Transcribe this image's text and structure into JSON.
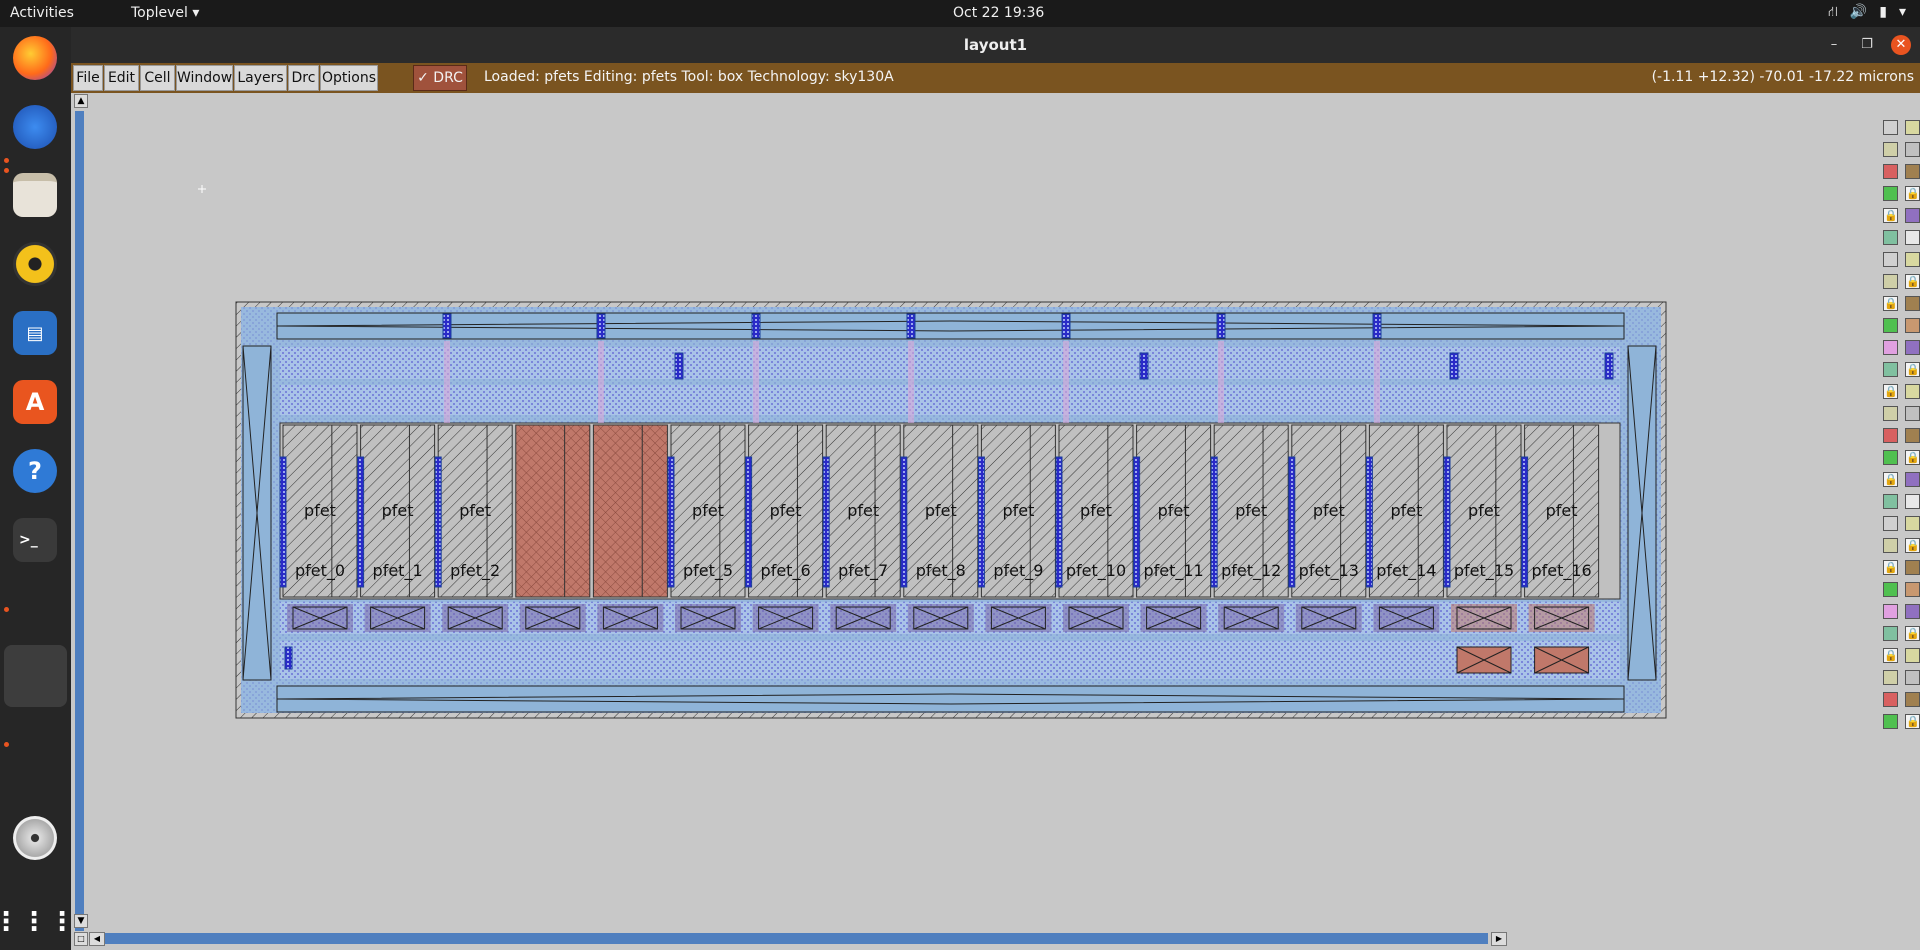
{
  "topbar": {
    "activities": "Activities",
    "app_menu": "Toplevel ▾",
    "clock": "Oct 22  19:36",
    "tray": [
      "⛙",
      "🔊",
      "▮",
      "▾"
    ]
  },
  "window": {
    "title": "layout1",
    "min": "–",
    "max": "❐",
    "close": "✕"
  },
  "menu": {
    "items": [
      "File",
      "Edit",
      "Cell",
      "Window",
      "Layers",
      "Drc",
      "Options"
    ],
    "drc_toggle": "✓ DRC",
    "status": "Loaded: pfets Editing: pfets Tool: box  Technology: sky130A",
    "coords": "(-1.11 +12.32) -70.01 -17.22 microns"
  },
  "layout": {
    "device_type": "pfet",
    "devices": [
      "pfet_0",
      "pfet_1",
      "pfet_2",
      "",
      "",
      "pfet_5",
      "pfet_6",
      "pfet_7",
      "pfet_8",
      "pfet_9",
      "pfet_10",
      "pfet_11",
      "pfet_12",
      "pfet_13",
      "pfet_14",
      "pfet_15",
      "pfet_16"
    ],
    "colors": {
      "nwell": "#8fb4d8",
      "diff": "#a9c3e8",
      "poly": "#c0786a",
      "metal": "#5a5ad0",
      "guard": "#1a3f9a",
      "background": "#c8c8c8"
    }
  },
  "dock": {
    "icons": [
      "firefox-icon",
      "thunderbird-icon",
      "files-icon",
      "rhythmbox-icon",
      "writer-icon",
      "software-icon",
      "help-icon",
      "terminal-icon",
      "blank-window-icon",
      "disc-icon",
      "apps-grid-icon"
    ]
  }
}
